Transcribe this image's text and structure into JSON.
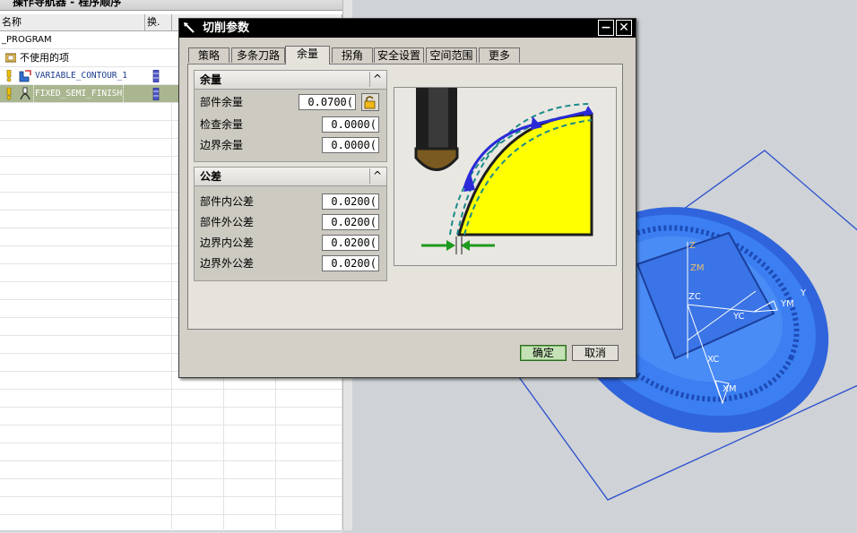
{
  "navigator": {
    "title": "操作导航器 - 程序顺序",
    "col_name": "名称",
    "col_change": "换.",
    "rows": [
      {
        "label": "_PROGRAM"
      },
      {
        "label": "不使用的项"
      },
      {
        "label": "VARIABLE_CONTOUR_1"
      },
      {
        "label": "FIXED_SEMI_FINISH"
      }
    ]
  },
  "dialog": {
    "title": "切削参数",
    "title_icon": "tool-icon",
    "min_label": "−",
    "close_label": "✕",
    "tabs": [
      "策略",
      "多条刀路",
      "余量",
      "拐角",
      "安全设置",
      "空间范围",
      "更多"
    ],
    "active_tab": "余量",
    "stock_group": {
      "title": "余量",
      "collapse": "^",
      "fields": [
        {
          "label": "部件余量",
          "value": "0.0700("
        },
        {
          "label": "检查余量",
          "value": "0.0000("
        },
        {
          "label": "边界余量",
          "value": "0.0000("
        }
      ]
    },
    "tolerance_group": {
      "title": "公差",
      "collapse": "^",
      "fields": [
        {
          "label": "部件内公差",
          "value": "0.0200("
        },
        {
          "label": "部件外公差",
          "value": "0.0200("
        },
        {
          "label": "边界内公差",
          "value": "0.0200("
        },
        {
          "label": "边界外公差",
          "value": "0.0200("
        }
      ]
    },
    "ok_label": "确定",
    "cancel_label": "取消"
  },
  "graphics": {
    "labels": {
      "z": "Z",
      "zm": "ZM",
      "zc": "ZC",
      "yc": "YC",
      "xc": "XC",
      "xm": "XM",
      "ym": "YM",
      "y": "Y"
    }
  },
  "colors": {
    "model": "#3b78f0",
    "dialog_bg": "#d4d0c8",
    "selected_row": "#a9b690",
    "ok_button": "#c4e2b6"
  }
}
